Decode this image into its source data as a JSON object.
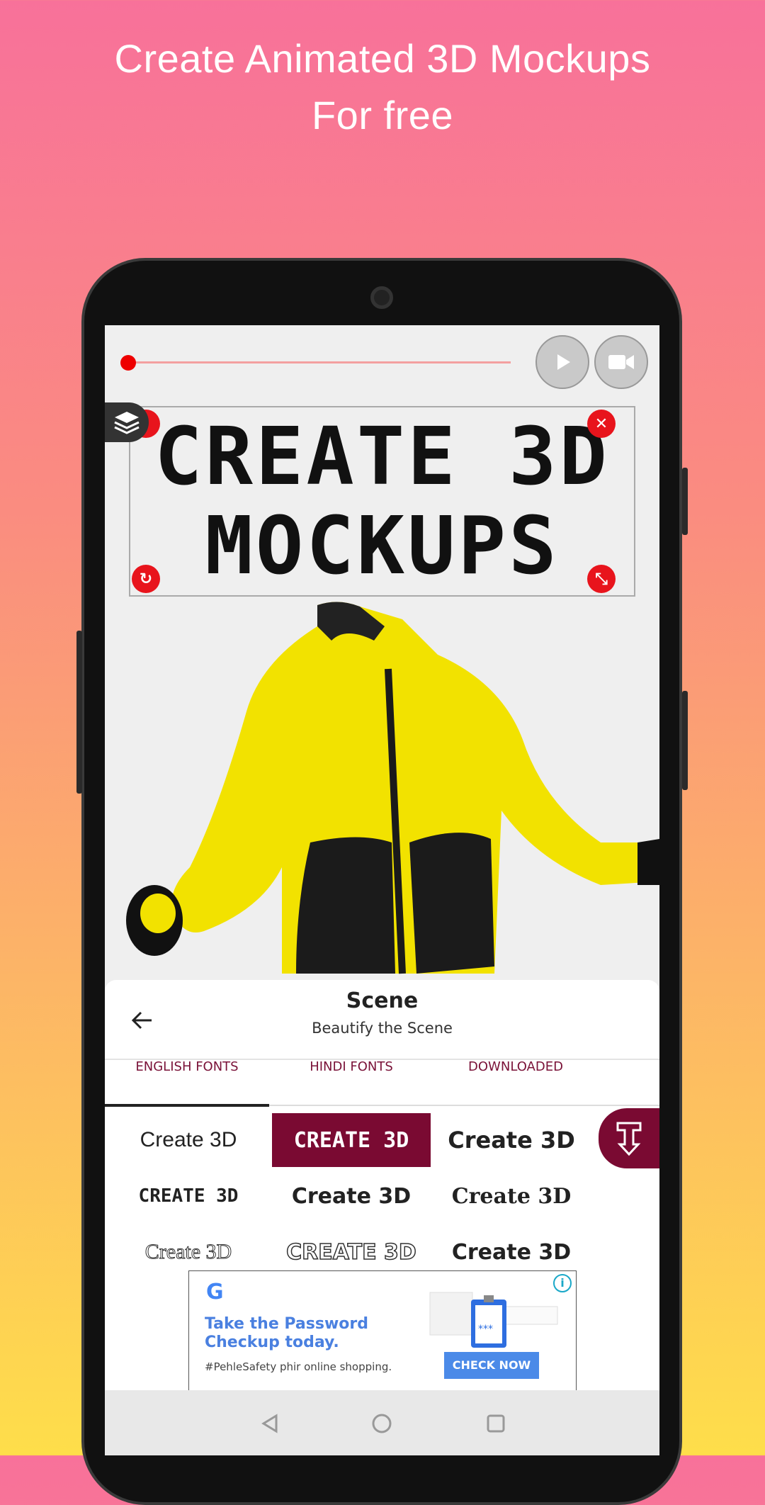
{
  "headline": {
    "line1": "Create Animated 3D Mockups",
    "line2": "For free"
  },
  "player": {
    "progress": 0,
    "play_icon": "play-icon",
    "record_icon": "video-camera-icon"
  },
  "canvas": {
    "text_line1": "CREATE 3D",
    "text_line2": "MOCKUPS",
    "layers_icon": "layers-icon",
    "handles": [
      "close-icon",
      "rotate-icon",
      "resize-icon"
    ]
  },
  "sheet": {
    "title": "Scene",
    "subtitle": "Beautify the Scene",
    "tabs": [
      {
        "label": "ENGLISH FONTS",
        "active": true
      },
      {
        "label": "HINDI FONTS"
      },
      {
        "label": "DOWNLOADED"
      }
    ],
    "fonts": [
      "Create 3D",
      "CREATE 3D",
      "Create 3D",
      "CREATE 3D",
      "Create 3D",
      "Create 3D",
      "Create 3D",
      "CREATE 3D",
      "Create 3D"
    ],
    "selected_index": 1,
    "accent": "#7a0a32"
  },
  "ad": {
    "headline": "Take the Password Checkup today.",
    "body": "#PehleSafety phir online shopping.",
    "cta": "CHECK NOW",
    "logo": "G"
  }
}
